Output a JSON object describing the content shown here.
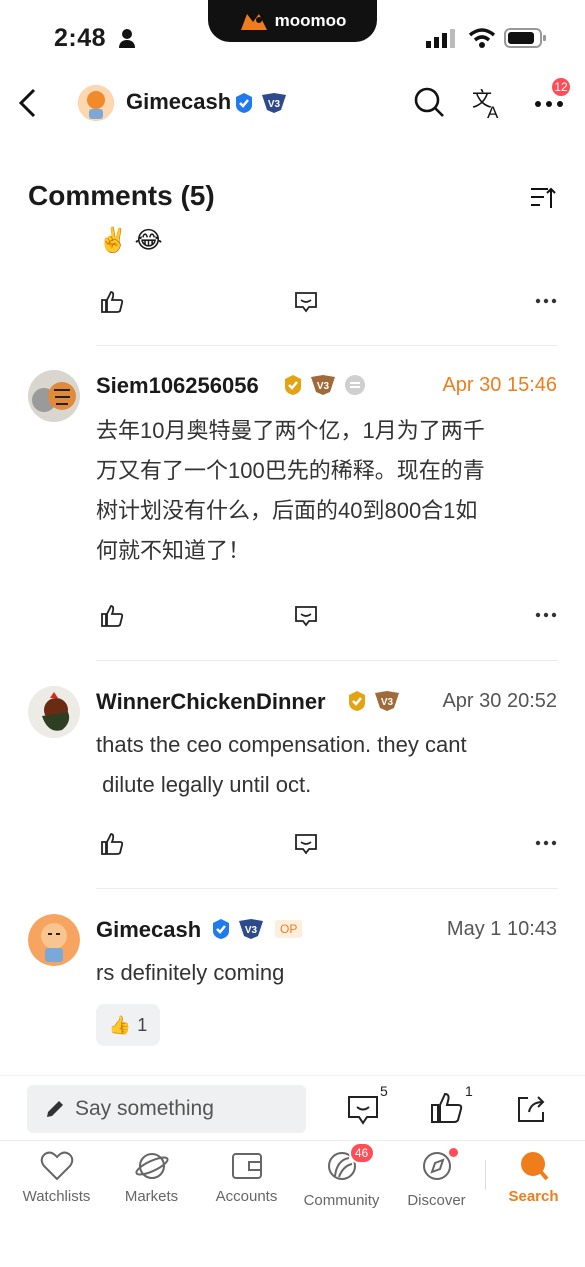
{
  "status_bar": {
    "time": "2:48",
    "brand": "moomoo"
  },
  "header": {
    "username": "Gimecash",
    "notification_count": "12"
  },
  "comments": {
    "title": "Comments (5)",
    "prev_emojis": "✌️ 😂",
    "items": [
      {
        "username": "Siem106256056",
        "date": "Apr 30 15:46",
        "text_line1": "去年10月奥特曼了两个亿，1月为了两千",
        "text_line2": "万又有了一个100巴先的稀释。现在的青",
        "text_line3": "树计划没有什么，后面的40到800合1如",
        "text_line4": "何就不知道了！"
      },
      {
        "username": "WinnerChickenDinner",
        "date": "Apr 30 20:52",
        "text_line1": "thats the ceo compensation. they cant",
        "text_line2": " dilute legally until oct."
      },
      {
        "username": "Gimecash",
        "date": "May 1 10:43",
        "op_tag": "OP",
        "text_line1": "rs definitely coming",
        "reaction_count": "1"
      }
    ]
  },
  "comment_bar": {
    "placeholder": "Say something",
    "comment_count": "5",
    "like_count": "1"
  },
  "tabs": [
    {
      "label": "Watchlists"
    },
    {
      "label": "Markets"
    },
    {
      "label": "Accounts"
    },
    {
      "label": "Community",
      "badge": "46"
    },
    {
      "label": "Discover"
    },
    {
      "label": "Search"
    }
  ],
  "colors": {
    "accent": "#f07d1c",
    "badge": "#ff4d57",
    "verified": "#1f7aec"
  }
}
